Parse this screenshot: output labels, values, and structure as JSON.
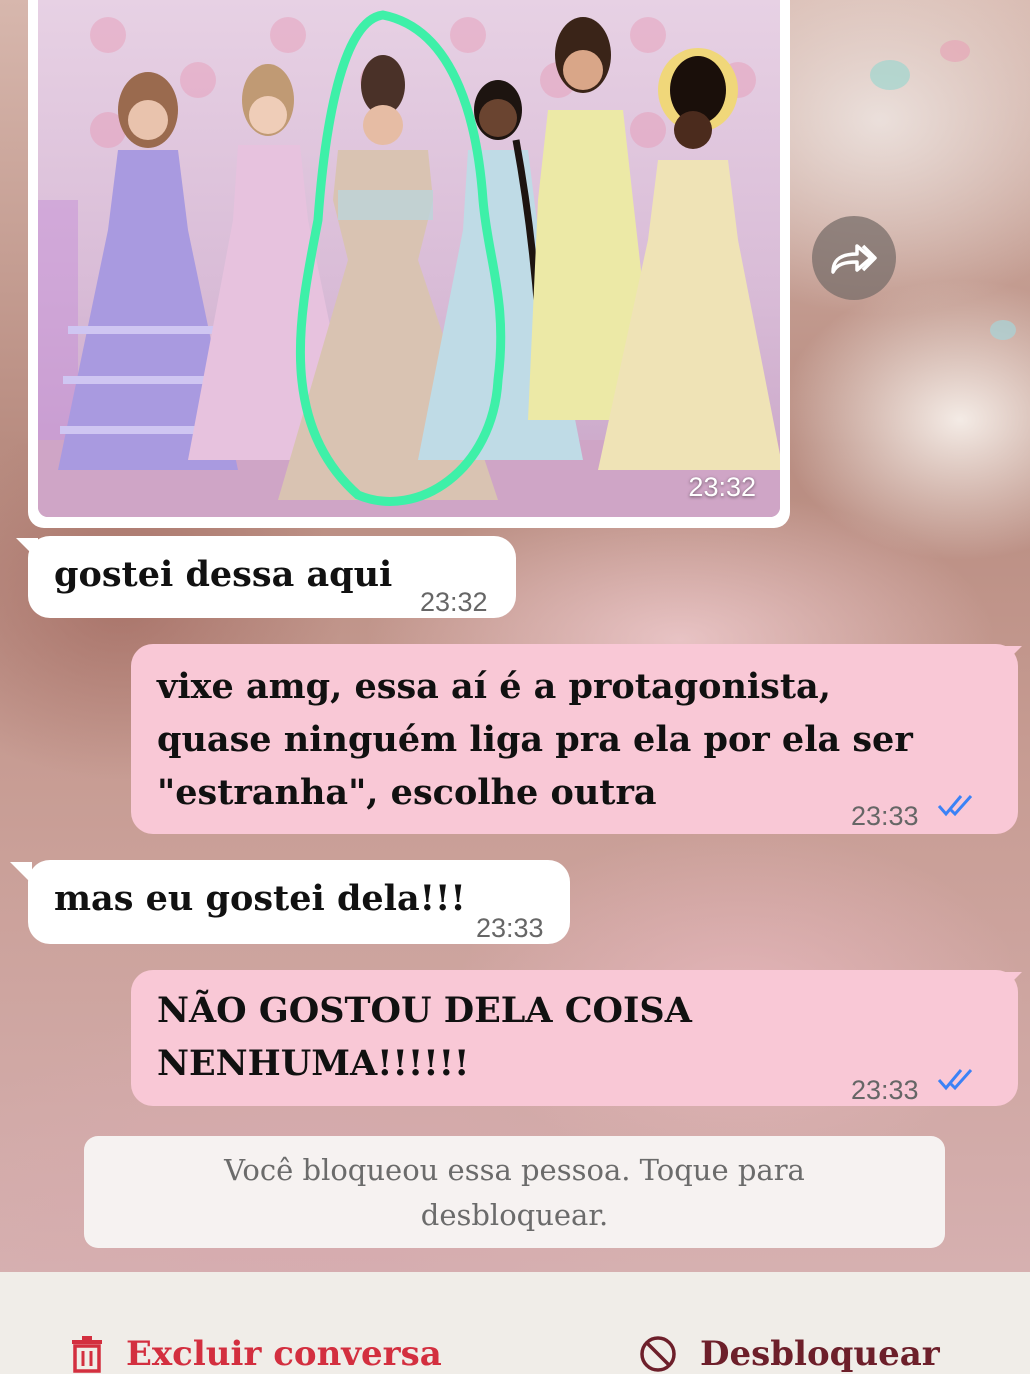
{
  "chat": {
    "image_message": {
      "time": "23:32"
    },
    "messages": [
      {
        "direction": "incoming",
        "text": "gostei dessa aqui",
        "time": "23:32"
      },
      {
        "direction": "outgoing",
        "lines": [
          "vixe amg, essa aí é a protagonista,",
          "quase ninguém liga pra ela por ela ser",
          "\"estranha\", escolhe outra"
        ],
        "time": "23:33",
        "status": "read"
      },
      {
        "direction": "incoming",
        "text": "mas eu gostei dela!!!",
        "time": "23:33"
      },
      {
        "direction": "outgoing",
        "lines": [
          "NÃO GOSTOU DELA COISA",
          "NENHUMA!!!!!!"
        ],
        "time": "23:33",
        "status": "read"
      }
    ],
    "blocked_notice": [
      "Você bloqueou essa pessoa. Toque para",
      "desbloquear."
    ]
  },
  "bottom_bar": {
    "delete_label": "Excluir conversa",
    "unblock_label": "Desbloquear",
    "delete_icon": "trash-icon",
    "unblock_icon": "block-icon"
  },
  "colors": {
    "outgoing_bubble": "#f9c8d6",
    "incoming_bubble": "#ffffff",
    "read_ticks": "#3b82f6",
    "delete_color": "#d32f3f",
    "unblock_color": "#6d1f2a",
    "highlight_circle": "#3ef0a8"
  }
}
